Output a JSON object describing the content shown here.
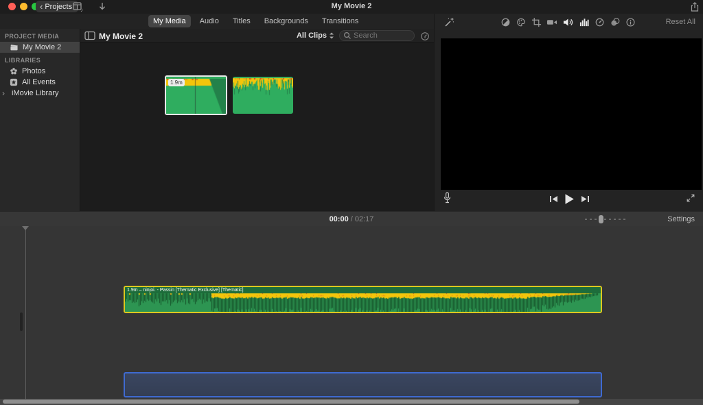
{
  "window": {
    "title": "My Movie 2"
  },
  "titlebar": {
    "back_button": "Projects"
  },
  "tabs": [
    {
      "label": "My Media",
      "active": true
    },
    {
      "label": "Audio",
      "active": false
    },
    {
      "label": "Titles",
      "active": false
    },
    {
      "label": "Backgrounds",
      "active": false
    },
    {
      "label": "Transitions",
      "active": false
    }
  ],
  "sidebar": {
    "project_media_header": "PROJECT MEDIA",
    "project_items": [
      {
        "label": "My Movie 2",
        "selected": true
      }
    ],
    "libraries_header": "LIBRARIES",
    "library_items": [
      {
        "label": "Photos"
      },
      {
        "label": "All Events"
      },
      {
        "label": "iMovie Library"
      }
    ]
  },
  "browser": {
    "title": "My Movie 2",
    "filter_label": "All Clips",
    "search_placeholder": "Search",
    "clips": [
      {
        "badge": "1.9m",
        "selected": true
      },
      {
        "badge": "",
        "selected": false
      }
    ]
  },
  "viewer": {
    "reset_all_label": "Reset All"
  },
  "timeline_toolbar": {
    "current_time": "00:00",
    "separator": "/",
    "total_time": "02:17",
    "settings_label": "Settings"
  },
  "timeline": {
    "audio_clip_label": "1.9m – ninjoi. - Passin [Thematic Exclusive] [Thematic]"
  },
  "colors": {
    "traffic_close": "#ff5f57",
    "traffic_minimize": "#febc2e",
    "traffic_zoom": "#28c840",
    "clip_green": "#2d9552",
    "clip_green_bright": "#2fad5f",
    "clip_green_dark": "#23814a",
    "wave_dark": "#155229",
    "wave_yellow": "#f3c50b",
    "wave_orange": "#e8831c",
    "wave_red": "#d8392b",
    "selection_yellow": "#ddc81f",
    "selection_white": "#e8e8e8",
    "drop_zone_blue": "#3f6ad1",
    "panel_dark": "#1c1c1c",
    "timeline_bg": "#353535"
  },
  "icons": {
    "close-icon": "red circle",
    "minimize-icon": "yellow circle",
    "zoom-icon": "green circle",
    "back-chevron-icon": "‹",
    "media-library-icon": "filmstrip+♪",
    "import-arrow-icon": "↓",
    "share-icon": "box with up arrow",
    "sidebar-toggle-icon": "split rectangle",
    "clapperboard-icon": "clapperboard",
    "photos-pinwheel-icon": "pinwheel flower",
    "all-events-star-icon": "★ in square",
    "disclosure-icon": "›",
    "filter-chevrons-icon": "⌃⌄",
    "search-icon": "⌕",
    "clip-appearance-icon": "dial circle",
    "enhance-wand-icon": "magic wand",
    "color-balance-icon": "half circle",
    "color-correction-icon": "palette",
    "crop-icon": "crop marks",
    "stabilization-icon": "video camera",
    "volume-icon": "speaker",
    "noise-eq-icon": "equalizer bars",
    "speed-icon": "gauge",
    "effects-icon": "overlapping circles",
    "info-icon": "ⓘ",
    "microphone-icon": "mic",
    "skip-back-icon": "|◀",
    "play-icon": "▶",
    "skip-forward-icon": "▶|",
    "fullscreen-icon": "⤢ arrows"
  }
}
